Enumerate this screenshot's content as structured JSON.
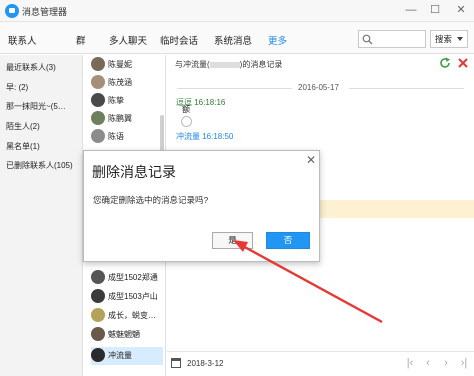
{
  "window": {
    "title": "消息管理器",
    "minimize": "—",
    "maximize": "☐",
    "close": "✕"
  },
  "tabs": [
    "联系人",
    "群",
    "多人聊天",
    "临时会话",
    "系统消息",
    "更多"
  ],
  "search": {
    "placeholder": "",
    "dropdown": "搜索"
  },
  "left_panel": [
    "最近联系人(3)",
    "早: (2)",
    "那一抹阳光~(5…",
    "陌生人(2)",
    "黑名单(1)",
    "已删除联系人(105)"
  ],
  "contacts": [
    "陈曼妮",
    "陈茂涵",
    "陈挚",
    "陈鹏翼",
    "陈语",
    "成型1502郑通",
    "成型1503卢山",
    "成长，蜕变…",
    "魃魅魍魉",
    "冲流量"
  ],
  "conversation": {
    "title_prefix": "与冲流量(",
    "title_suffix": ")的消息记录",
    "date": "2016-05-17",
    "msg1_header": "逗逗 16:18:16",
    "msg1_body": "额",
    "msg2_header": "冲流量 16:18:50"
  },
  "bottom": {
    "date": "2018-3-12"
  },
  "dialog": {
    "title": "删除消息记录",
    "message": "您确定删除选中的消息记录吗?",
    "yes": "是",
    "no": "否",
    "close": "✕"
  },
  "colors": {
    "accent": "#2196f3",
    "annotation_arrow": "#e53935",
    "highlight_strip": "#fdf1d2"
  },
  "icons": [
    "app-icon",
    "search-icon",
    "refresh-icon",
    "delete-icon",
    "calendar-icon",
    "first-page-icon",
    "prev-page-icon",
    "next-page-icon",
    "last-page-icon",
    "close-icon"
  ]
}
